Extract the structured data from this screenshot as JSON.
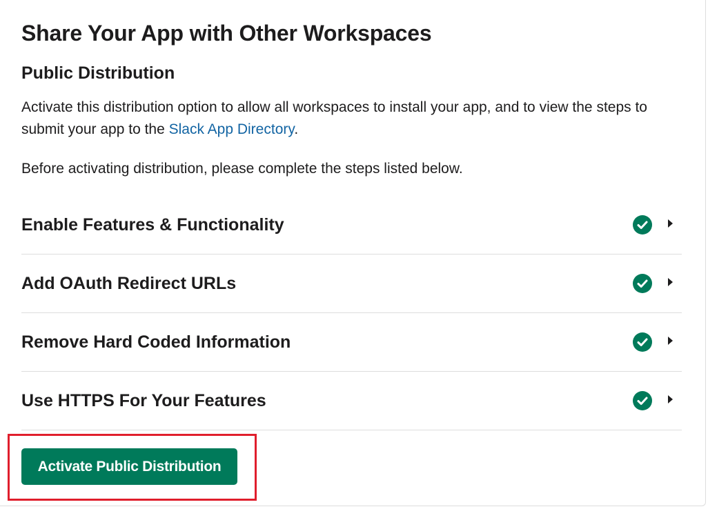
{
  "section": {
    "title": "Share Your App with Other Workspaces",
    "subtitle": "Public Distribution",
    "description_before": "Activate this distribution option to allow all workspaces to install your app, and to view the steps to submit your app to the ",
    "description_link": "Slack App Directory",
    "description_after": ".",
    "note": "Before activating distribution, please complete the steps listed below."
  },
  "steps": [
    {
      "label": "Enable Features & Functionality",
      "status": "complete"
    },
    {
      "label": "Add OAuth Redirect URLs",
      "status": "complete"
    },
    {
      "label": "Remove Hard Coded Information",
      "status": "complete"
    },
    {
      "label": "Use HTTPS For Your Features",
      "status": "complete"
    }
  ],
  "activate_button": {
    "label": "Activate Public Distribution"
  },
  "colors": {
    "accent": "#007a5a",
    "link": "#1264a3",
    "highlight": "#e01e2c"
  }
}
